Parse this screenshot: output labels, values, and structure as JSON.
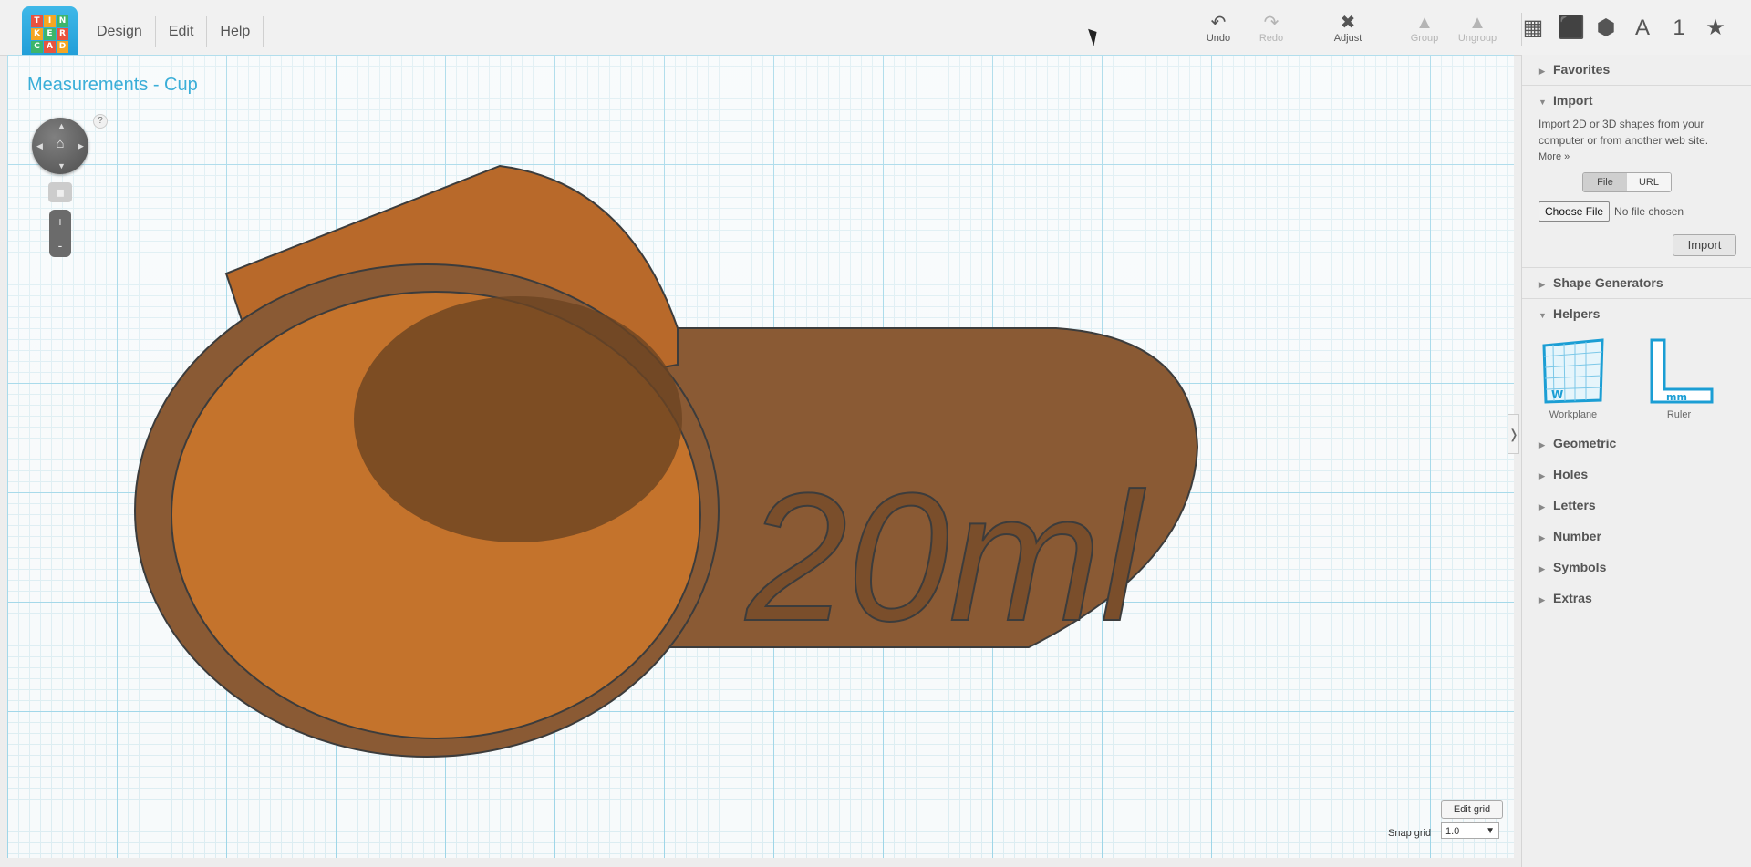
{
  "app": {
    "logo_letters": [
      "T",
      "I",
      "N",
      "K",
      "E",
      "R",
      "C",
      "A",
      "D"
    ],
    "menu": [
      "Design",
      "Edit",
      "Help"
    ]
  },
  "toolbar": {
    "undo": "Undo",
    "redo": "Redo",
    "adjust": "Adjust",
    "group": "Group",
    "ungroup": "Ungroup",
    "view_tools": [
      {
        "name": "workplane-view-icon",
        "glyph": "▦"
      },
      {
        "name": "box-view-icon",
        "glyph": "⬛"
      },
      {
        "name": "wireframe-view-icon",
        "glyph": "⬢"
      },
      {
        "name": "text-tool-icon",
        "glyph": "A"
      },
      {
        "name": "number-tool-icon",
        "glyph": "1"
      },
      {
        "name": "favorites-star-icon",
        "glyph": "★"
      }
    ]
  },
  "workspace": {
    "title": "Measurements - Cup",
    "model_text": "20ml",
    "help": "?",
    "zoom_in": "+",
    "zoom_out": "-",
    "edit_grid": "Edit grid",
    "snap_grid_label": "Snap grid",
    "snap_grid_value": "1.0",
    "model_color": "#8a5a34",
    "model_accent": "#c8732a"
  },
  "sidebar": {
    "favorites": "Favorites",
    "import": {
      "title": "Import",
      "description": "Import 2D or 3D shapes from your computer or from another web site.",
      "more": "More »",
      "tab_file": "File",
      "tab_url": "URL",
      "choose_file": "Choose File",
      "no_file": "No file chosen",
      "import_button": "Import"
    },
    "shape_generators": "Shape Generators",
    "helpers": {
      "title": "Helpers",
      "items": [
        "Workplane",
        "Ruler"
      ]
    },
    "sections": [
      "Geometric",
      "Holes",
      "Letters",
      "Number",
      "Symbols",
      "Extras"
    ]
  }
}
